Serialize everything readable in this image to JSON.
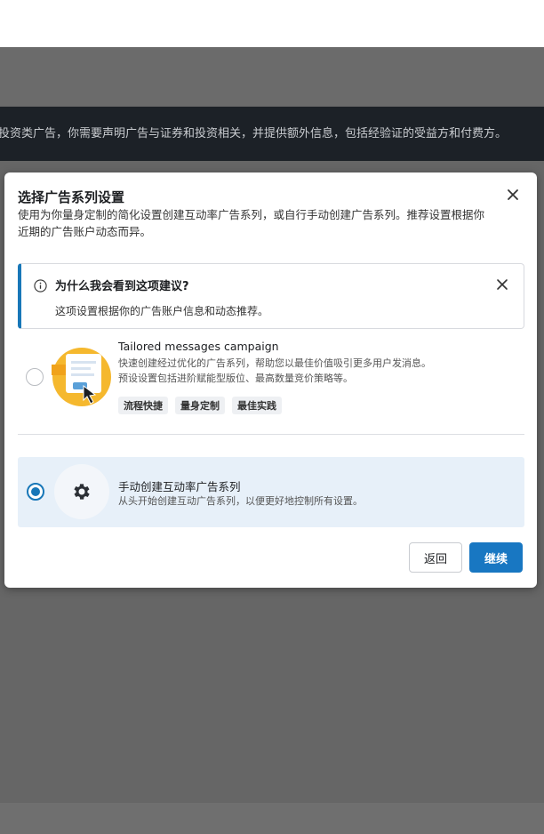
{
  "background": {
    "banner_text": "投资类广告，你需要声明广告与证券和投资相关，并提供额外信息，包括经验证的受益方和付费方。"
  },
  "modal": {
    "title": "选择广告系列设置",
    "description": "使用为你量身定制的简化设置创建互动率广告系列，或自行手动创建广告系列。推荐设置根据你近期的广告账户动态而异。",
    "close_icon": "close-icon"
  },
  "info": {
    "icon": "info-icon",
    "title": "为什么我会看到这项建议?",
    "text": "这项设置根据你的广告账户信息和动态推荐。"
  },
  "options": [
    {
      "title": "Tailored messages campaign",
      "desc_line1": "快速创建经过优化的广告系列，帮助您以最佳价值吸引更多用户发消息。",
      "desc_line2": "预设设置包括进阶赋能型版位、最高数量竞价策略等。",
      "tags": [
        "流程快捷",
        "量身定制",
        "最佳实践"
      ],
      "selected": false
    },
    {
      "title": "手动创建互动率广告系列",
      "desc": "从头开始创建互动广告系列，以便更好地控制所有设置。",
      "icon": "gear-icon",
      "selected": true
    }
  ],
  "buttons": {
    "back": "返回",
    "continue": "继续"
  },
  "colors": {
    "accent": "#1877c2",
    "selected_bg": "#e7f0f9"
  }
}
